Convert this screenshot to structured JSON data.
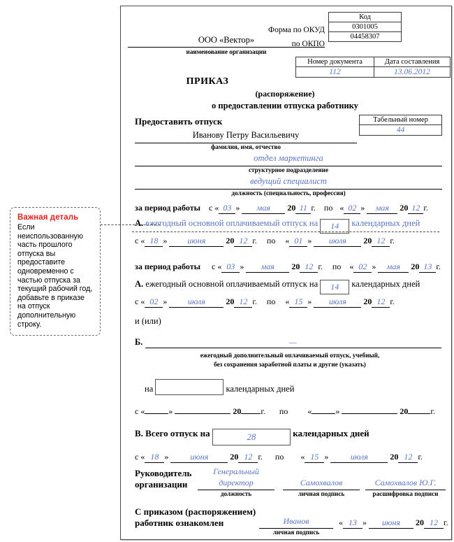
{
  "callout": {
    "title": "Важная деталь",
    "body": "Если неиспользованную часть прошлого отпуска вы предоставите одновременно с частью отпуска за текущий рабочий год, добавьте в приказе на отпуск дополнительную строку."
  },
  "header": {
    "code_label": "Код",
    "okud_label": "Форма по ОКУД",
    "okud_value": "0301005",
    "okpo_label": "по ОКПО",
    "okpo_value": "04458307",
    "org_name": "ООО «Вектор»",
    "org_caption": "наименование организации",
    "doc_number_label": "Номер документа",
    "doc_date_label": "Дата составления",
    "doc_number": "112",
    "doc_date": "13.06.2012"
  },
  "title": {
    "line1": "ПРИКАЗ",
    "line2": "(распоряжение)",
    "line3": "о предоставлении отпуска работнику"
  },
  "employee": {
    "grant_label": "Предоставить отпуск",
    "tab_number_label": "Табельный номер",
    "tab_number": "44",
    "fio": "Иванову Петру Васильевичу",
    "fio_caption": "фамилия, имя, отчество",
    "department": "отдел маркетинга",
    "department_caption": "структурное подразделение",
    "position": "ведущий специалист",
    "position_caption": "должность (специальность, профессия)"
  },
  "labels": {
    "period_work": "за период работы",
    "from": "с",
    "to": "по",
    "year_prefix": "20",
    "year_suffix": "г.",
    "quote_open": "«",
    "quote_close": "»",
    "section_a": "А.",
    "section_b": "Б.",
    "section_v": "В.",
    "annual_main": "ежегодный основной оплачиваемый отпуск на",
    "calendar_days": "календарных дней",
    "and_or": "и (или)",
    "b_caption_1": "ежегодный дополнительный оплачиваемый отпуск, учебный,",
    "b_caption_2": "без сохранения заработной платы и другие (указать)",
    "on": "на",
    "total_leave": "Всего отпуск на",
    "head_line1": "Руководитель",
    "head_line2": "организации",
    "cap_position": "должность",
    "cap_signature": "личная подпись",
    "cap_decoding": "расшифровка подписи",
    "ack_line1": "С приказом (распоряжением)",
    "ack_line2": "работник ознакомлен"
  },
  "block1": {
    "period_from_day": "03",
    "period_from_month": "мая",
    "period_from_year": "11",
    "period_to_day": "02",
    "period_to_month": "мая",
    "period_to_year": "12",
    "days": "14",
    "leave_from_day": "18",
    "leave_from_month": "июня",
    "leave_from_year": "12",
    "leave_to_day": "01",
    "leave_to_month": "июля",
    "leave_to_year": "12"
  },
  "block2": {
    "period_from_day": "03",
    "period_from_month": "мая",
    "period_from_year": "12",
    "period_to_day": "02",
    "period_to_month": "мая",
    "period_to_year": "13",
    "days": "14",
    "leave_from_day": "02",
    "leave_from_month": "июля",
    "leave_from_year": "12",
    "leave_to_day": "15",
    "leave_to_month": "июля",
    "leave_to_year": "12"
  },
  "section_b": {
    "value": "—",
    "days": "",
    "from_day": "",
    "from_month": "",
    "from_year": "",
    "to_day": "",
    "to_month": "",
    "to_year": ""
  },
  "section_v": {
    "total_days": "28",
    "from_day": "18",
    "from_month": "июня",
    "from_year": "12",
    "to_day": "15",
    "to_month": "июля",
    "to_year": "12"
  },
  "signature": {
    "position_line1": "Генеральный",
    "position_line2": "директор",
    "signature": "Самохвалов",
    "decoding": "Самохвалов Ю.Г."
  },
  "acknowledgement": {
    "signature": "Иванов",
    "day": "13",
    "month": "июня",
    "year": "12"
  },
  "colors": {
    "accent_red": "#e3231e",
    "value_blue": "#5b76c4"
  }
}
